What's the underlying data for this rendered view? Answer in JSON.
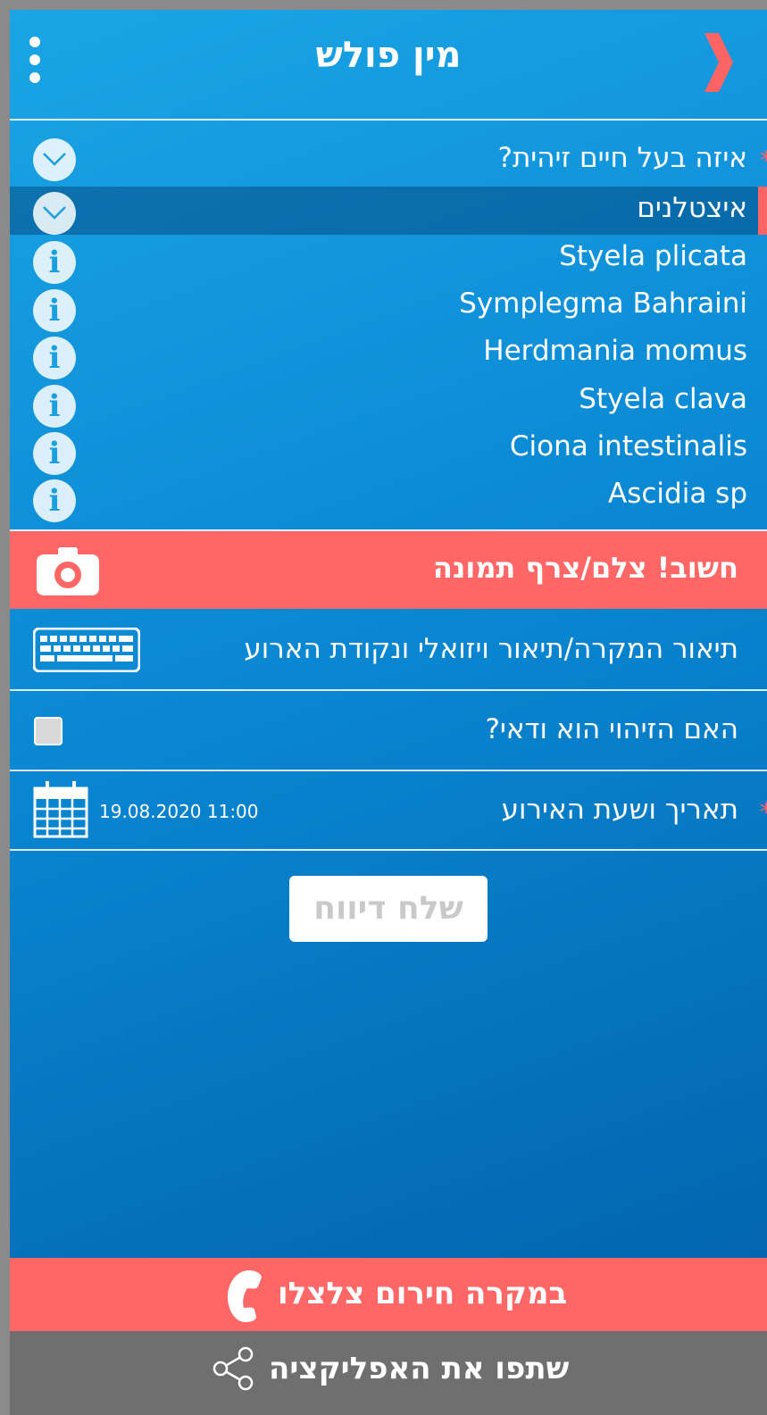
{
  "header": {
    "title": "מין פולש"
  },
  "question": {
    "label": "איזה בעל חיים זיהית?",
    "required_mark": "*"
  },
  "selected": {
    "label": "איצטלנים"
  },
  "species": [
    "Styela plicata",
    "Symplegma Bahraini",
    "Herdmania momus",
    "Styela clava",
    "Ciona intestinalis",
    "Ascidia sp"
  ],
  "photo": {
    "label": "חשוב! צלם/צרף תמונה"
  },
  "description": {
    "placeholder": "תיאור המקרה/תיאור ויזואלי ונקודת הארוע"
  },
  "certain": {
    "label": "האם הזיהוי הוא ודאי?",
    "checked": false
  },
  "datetime": {
    "label": "תאריך ושעת האירוע",
    "value": "19.08.2020 11:00",
    "required_mark": "*"
  },
  "submit": {
    "label": "שלח דיווח"
  },
  "emergency": {
    "label": "במקרה חירום צלצלו"
  },
  "share": {
    "label": "שתפו את האפליקציה"
  },
  "colors": {
    "accent": "#ff6767",
    "bg_top": "#1aa5e6",
    "bg_bottom": "#005ea8",
    "share_bar": "#6f6f6f"
  }
}
